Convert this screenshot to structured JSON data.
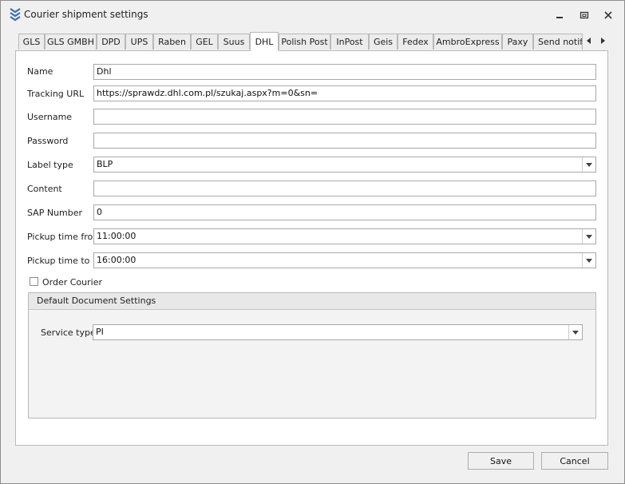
{
  "window": {
    "title": "Courier shipment settings"
  },
  "tabs": [
    {
      "label": "GLS",
      "active": false
    },
    {
      "label": "GLS GMBH",
      "active": false
    },
    {
      "label": "DPD",
      "active": false
    },
    {
      "label": "UPS",
      "active": false
    },
    {
      "label": "Raben",
      "active": false
    },
    {
      "label": "GEL",
      "active": false
    },
    {
      "label": "Suus",
      "active": false
    },
    {
      "label": "DHL",
      "active": true
    },
    {
      "label": "Polish Post",
      "active": false
    },
    {
      "label": "InPost",
      "active": false
    },
    {
      "label": "Geis",
      "active": false
    },
    {
      "label": "Fedex",
      "active": false
    },
    {
      "label": "AmbroExpress",
      "active": false
    },
    {
      "label": "Paxy",
      "active": false
    },
    {
      "label": "Send notifi",
      "active": false
    }
  ],
  "form": {
    "name": {
      "label": "Name",
      "value": "Dhl"
    },
    "tracking_url": {
      "label": "Tracking URL",
      "value": "https://sprawdz.dhl.com.pl/szukaj.aspx?m=0&sn="
    },
    "username": {
      "label": "Username",
      "value": ""
    },
    "password": {
      "label": "Password",
      "value": ""
    },
    "label_type": {
      "label": "Label type",
      "value": "BLP"
    },
    "content": {
      "label": "Content",
      "value": ""
    },
    "sap_number": {
      "label": "SAP Number",
      "value": "0"
    },
    "pickup_from": {
      "label": "Pickup time from",
      "value": "11:00:00"
    },
    "pickup_to": {
      "label": "Pickup time to",
      "value": "16:00:00"
    },
    "order_courier": {
      "label": "Order Courier",
      "checked": false
    }
  },
  "document_settings": {
    "title": "Default Document Settings",
    "service_type": {
      "label": "Service type",
      "value": "PI"
    }
  },
  "buttons": {
    "save": "Save",
    "cancel": "Cancel"
  },
  "colors": {
    "accent_icon": "#3b6fb6",
    "window_bg": "#f0f0f0",
    "border": "#a9a9a9"
  }
}
